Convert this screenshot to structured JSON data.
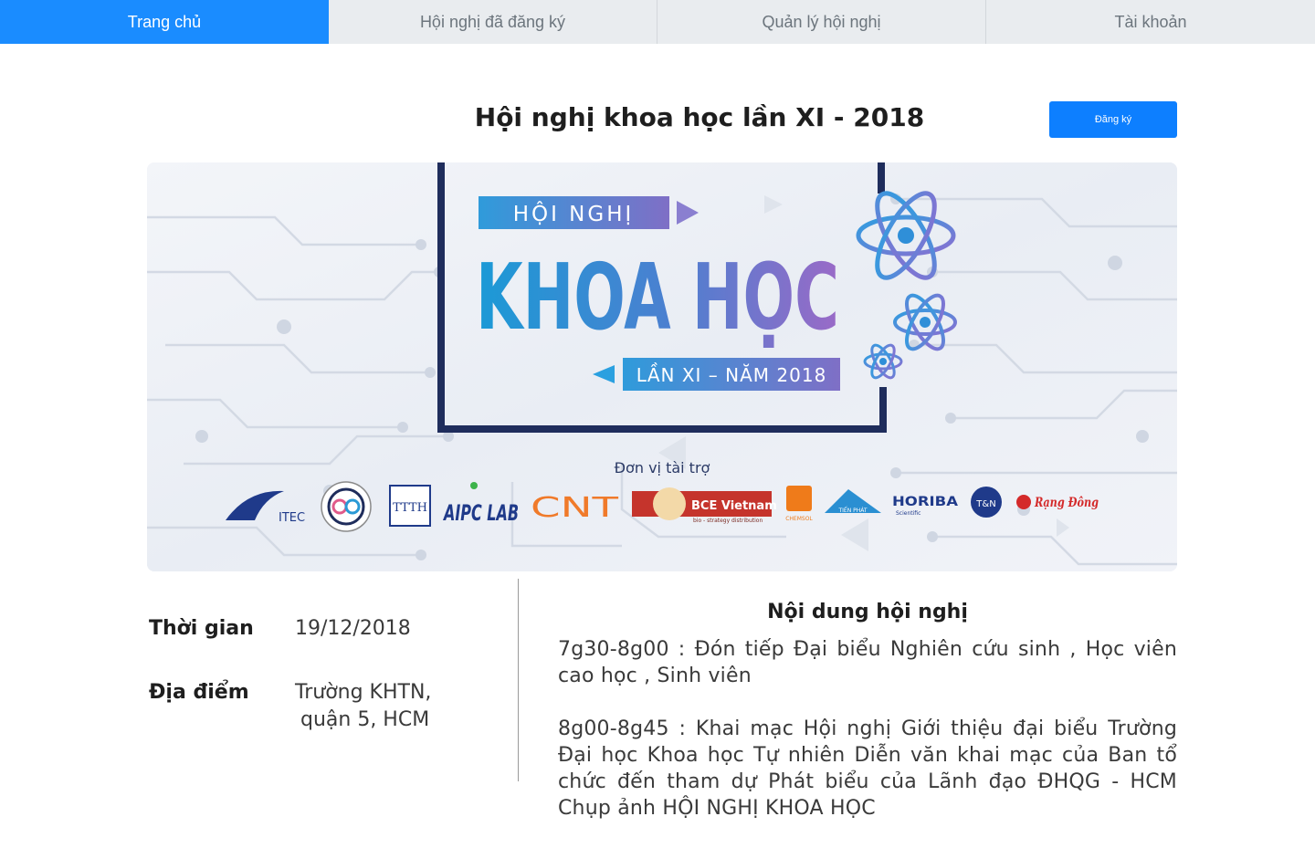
{
  "nav": {
    "tabs": [
      {
        "label": "Trang chủ",
        "active": true
      },
      {
        "label": "Hội nghị đã đăng ký",
        "active": false
      },
      {
        "label": "Quản lý hội nghị",
        "active": false
      },
      {
        "label": "Tài khoản",
        "active": false
      }
    ]
  },
  "conference": {
    "title": "Hội nghị khoa học lần XI - 2018",
    "register_label": "Đăng ký"
  },
  "banner": {
    "line1": "HỘI  NGHỊ",
    "line2": "KHOA HỌC",
    "line3": "LẦN XI – NĂM 2018",
    "sponsor_heading": "Đơn vị tài trợ",
    "sponsors": [
      "ITEC",
      "TTTH",
      "AIPC LAB",
      "CNT",
      "BCE Vietnam",
      "CHEMSOL",
      "TIẾN PHÁT",
      "HORIBA",
      "T&N",
      "Rạng Đông"
    ],
    "sponsor_sub": {
      "bce": "bio - strategy distribution",
      "horiba": "Scientific"
    }
  },
  "info": {
    "time_label": "Thời gian",
    "time_value": "19/12/2018",
    "place_label": "Địa điểm",
    "place_line1": "Trường KHTN,",
    "place_line2": "quận 5, HCM"
  },
  "agenda": {
    "title": "Nội dung hội nghị",
    "items": [
      "7g30-8g00 : Đón tiếp Đại biểu Nghiên cứu sinh , Học viên cao học , Sinh viên",
      "8g00-8g45 : Khai mạc Hội nghị Giới thiệu đại biểu Trường Đại học Khoa học Tự nhiên Diễn văn khai mạc của Ban tổ chức đến tham dự Phát biểu của Lãnh đạo ĐHQG - HCM Chụp ảnh HỘI NGHỊ KHOA HỌC"
    ]
  },
  "colors": {
    "nav_active": "#1a8cff",
    "button": "#0d7fff",
    "banner_frame": "#1f2d5c"
  }
}
